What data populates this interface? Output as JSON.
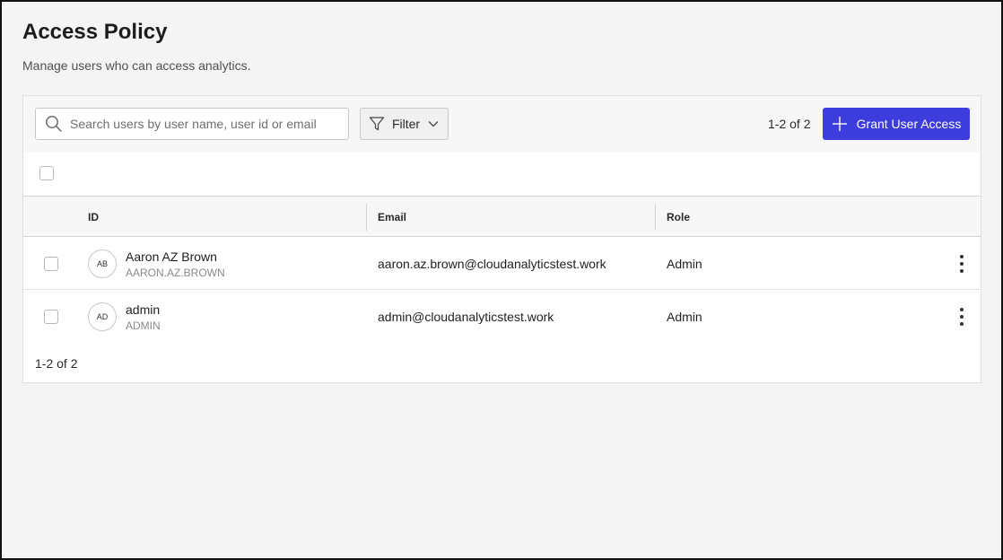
{
  "page": {
    "title": "Access Policy",
    "subtitle": "Manage users who can access analytics."
  },
  "toolbar": {
    "search_placeholder": "Search users by user name, user id or email",
    "search_value": "",
    "filter_label": "Filter",
    "count_label": "1-2 of 2",
    "grant_label": "Grant User Access"
  },
  "table": {
    "columns": [
      "ID",
      "Email",
      "Role"
    ],
    "rows": [
      {
        "initials": "AB",
        "name": "Aaron AZ Brown",
        "user_id": "AARON.AZ.BROWN",
        "email": "aaron.az.brown@cloudanalyticstest.work",
        "role": "Admin"
      },
      {
        "initials": "AD",
        "name": "admin",
        "user_id": "ADMIN",
        "email": "admin@cloudanalyticstest.work",
        "role": "Admin"
      }
    ]
  },
  "footer": {
    "count_label": "1-2 of 2"
  },
  "colors": {
    "accent": "#3d3cdc",
    "background": "#f4f4f4"
  },
  "icons": {
    "search": "search-icon",
    "filter": "filter-icon",
    "chevron": "chevron-down-icon",
    "plus": "plus-icon",
    "more": "more-vertical-icon"
  }
}
